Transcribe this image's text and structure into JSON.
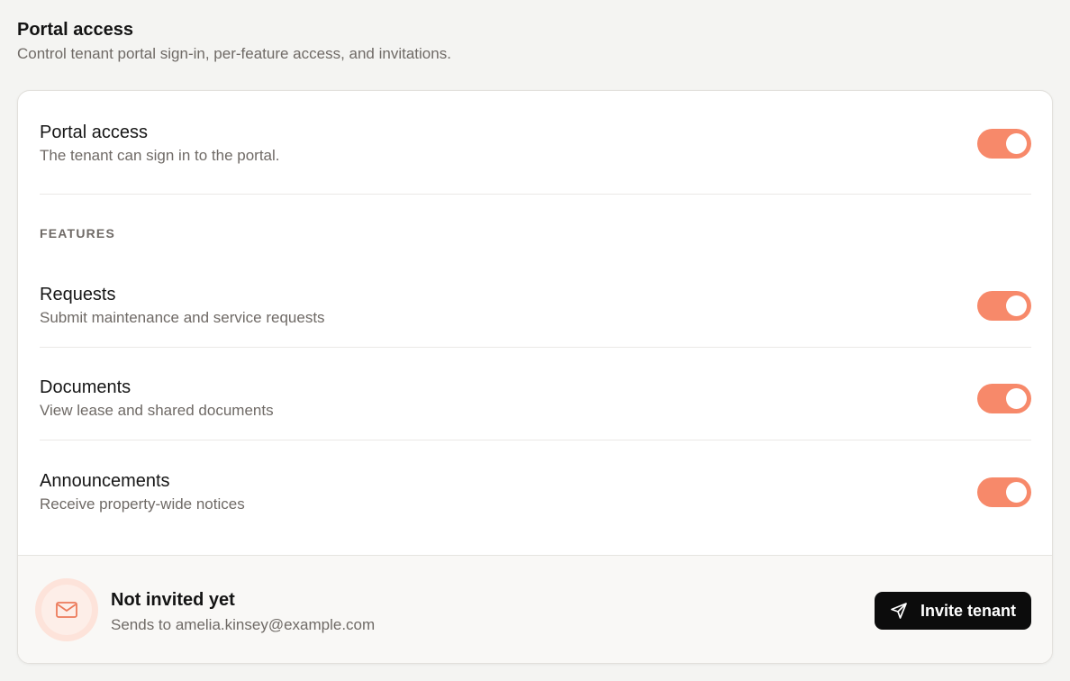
{
  "page": {
    "title": "Portal access",
    "subtitle": "Control tenant portal sign-in, per-feature access, and invitations."
  },
  "access": {
    "title": "Portal access",
    "description": "The tenant can sign in to the portal.",
    "enabled": true
  },
  "features": {
    "section_label": "FEATURES",
    "items": [
      {
        "title": "Requests",
        "description": "Submit maintenance and service requests",
        "enabled": true
      },
      {
        "title": "Documents",
        "description": "View lease and shared documents",
        "enabled": true
      },
      {
        "title": "Announcements",
        "description": "Receive property-wide notices",
        "enabled": true
      }
    ]
  },
  "invite": {
    "status": "Not invited yet",
    "description": "Sends to amelia.kinsey@example.com",
    "button_label": "Invite tenant",
    "icon": "mail-icon",
    "button_icon": "send-icon"
  },
  "colors": {
    "accent": "#f7896a",
    "button": "#0c0c0c",
    "background": "#f4f4f2"
  }
}
